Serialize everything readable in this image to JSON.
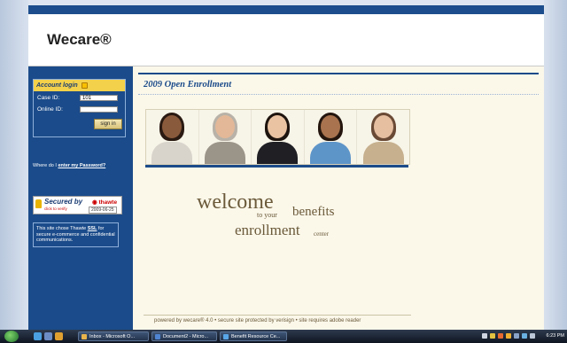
{
  "site": {
    "brand": "Wecare®"
  },
  "login": {
    "title": "Account login",
    "case_id_label": "Case ID:",
    "case_id_value": "101",
    "online_id_label": "Online ID:",
    "online_id_value": "",
    "signin_label": "sign in"
  },
  "forgot": {
    "prefix": "Where do I",
    "link": "enter my Password?"
  },
  "thawte": {
    "secured": "Secured by",
    "brand": "thawte",
    "click": "click to verify",
    "date": "2009-06-25"
  },
  "ssl_note": {
    "pre": "This site chose Thawte",
    "ssl": "SSL",
    "post": "for secure e-commerce and confidential communications."
  },
  "main": {
    "title": "2009 Open Enrollment",
    "welcome": "welcome",
    "to_your": "to your",
    "benefits": "benefits",
    "enrollment": "enrollment",
    "center": "center",
    "footer": "powered by wecare® 4.0 • secure site protected by verisign • site requires adobe reader"
  },
  "taskbar": {
    "tasks": [
      "Inbox - Microsoft O...",
      "Document2 - Micro...",
      "Benefit Resource Ce..."
    ],
    "clock": "6:23 PM"
  },
  "colors": {
    "primary": "#1b4b8a",
    "accent": "#f4d14a",
    "background": "#fbf8ea"
  }
}
